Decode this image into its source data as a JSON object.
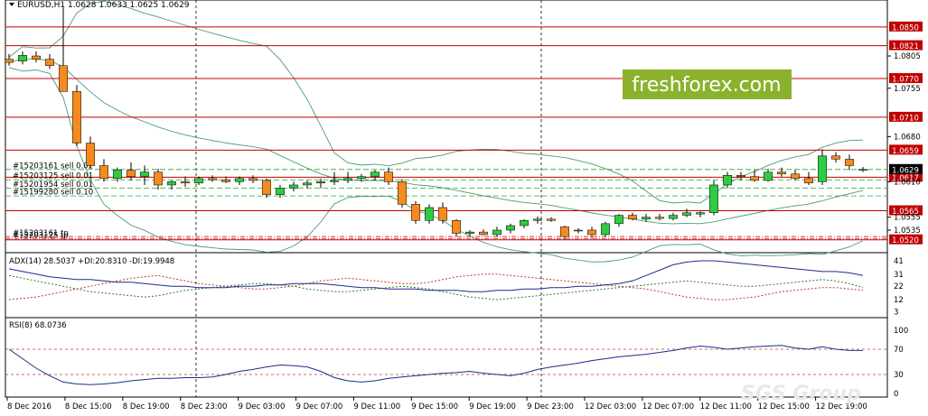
{
  "window": {
    "title": "EURUSD,H1  1.0628 1.0633 1.0625 1.0629",
    "watermark": "freshforex.com",
    "watermark_bottom": "SGS Group"
  },
  "colors": {
    "up_candle": "#2ecc40",
    "down_candle": "#f58a1f",
    "level_line": "#c00000",
    "order_line": "#2ea12e",
    "bollinger": "#4a9a7a",
    "price_badge_red": "#c00000",
    "price_badge_current": "#000000",
    "watermark_bg": "#8bb22d",
    "adx_line": "#1f2a8a",
    "di_plus": "#2e7d32",
    "di_minus": "#c0392b",
    "rsi_line": "#1f2a8a",
    "rsi_level": "#c0392b"
  },
  "price_axis": {
    "ticks": [
      "1.0805",
      "1.0755",
      "1.0680",
      "1.0610",
      "1.0555",
      "1.0535"
    ],
    "ylim": [
      1.05,
      1.0875
    ]
  },
  "levels": [
    {
      "price": 1.085,
      "label": "1.0850"
    },
    {
      "price": 1.0821,
      "label": "1.0821"
    },
    {
      "price": 1.077,
      "label": "1.0770"
    },
    {
      "price": 1.071,
      "label": "1.0710"
    },
    {
      "price": 1.0659,
      "label": "1.0659"
    },
    {
      "price": 1.0617,
      "label": "1.0617"
    },
    {
      "price": 1.0565,
      "label": "1.0565"
    },
    {
      "price": 1.052,
      "label": "1.0520"
    }
  ],
  "current_price": {
    "price": 1.0629,
    "label": "1.0629"
  },
  "orders": [
    {
      "price": 1.0629,
      "label": "#15203161 sell 0.02"
    },
    {
      "price": 1.0613,
      "label": "#15203125 sell 0.01"
    },
    {
      "price": 1.06,
      "label": "#15201954 sell 0.01"
    },
    {
      "price": 1.0588,
      "label": "#15199280 sell 0.10"
    }
  ],
  "tp_lines": [
    {
      "price": 1.0525,
      "label": "#15203161 tp"
    },
    {
      "price": 1.0522,
      "label": "#15203125 tp"
    }
  ],
  "chart_data": {
    "type": "candlestick",
    "symbol": "EURUSD",
    "timeframe": "H1",
    "ohlc_header": [
      1.0628,
      1.0633,
      1.0625,
      1.0629
    ],
    "candles": [
      [
        1.08,
        1.0808,
        1.079,
        1.0795
      ],
      [
        1.0797,
        1.0812,
        1.0792,
        1.0806
      ],
      [
        1.0805,
        1.0812,
        1.0795,
        1.08
      ],
      [
        1.08,
        1.0808,
        1.0785,
        1.079
      ],
      [
        1.079,
        1.088,
        1.0755,
        1.075
      ],
      [
        1.075,
        1.076,
        1.0665,
        1.067
      ],
      [
        1.067,
        1.068,
        1.0632,
        1.0635
      ],
      [
        1.0635,
        1.0645,
        1.061,
        1.0615
      ],
      [
        1.0615,
        1.0632,
        1.061,
        1.0628
      ],
      [
        1.0628,
        1.064,
        1.0612,
        1.0618
      ],
      [
        1.0618,
        1.0635,
        1.0605,
        1.0625
      ],
      [
        1.0625,
        1.063,
        1.0598,
        1.0605
      ],
      [
        1.0605,
        1.0612,
        1.0598,
        1.061
      ],
      [
        1.061,
        1.0618,
        1.0602,
        1.0608
      ],
      [
        1.0608,
        1.0618,
        1.0605,
        1.0615
      ],
      [
        1.0615,
        1.062,
        1.061,
        1.0613
      ],
      [
        1.0613,
        1.0618,
        1.0608,
        1.061
      ],
      [
        1.061,
        1.0618,
        1.0605,
        1.0615
      ],
      [
        1.0615,
        1.062,
        1.0608,
        1.0612
      ],
      [
        1.0612,
        1.0615,
        1.0585,
        1.059
      ],
      [
        1.059,
        1.0605,
        1.0585,
        1.06
      ],
      [
        1.06,
        1.061,
        1.0595,
        1.0605
      ],
      [
        1.0605,
        1.0612,
        1.06,
        1.0608
      ],
      [
        1.0608,
        1.0615,
        1.06,
        1.061
      ],
      [
        1.061,
        1.0625,
        1.0605,
        1.0612
      ],
      [
        1.0612,
        1.0625,
        1.0608,
        1.0615
      ],
      [
        1.0615,
        1.0622,
        1.061,
        1.0618
      ],
      [
        1.0618,
        1.0628,
        1.0612,
        1.0625
      ],
      [
        1.0625,
        1.0632,
        1.0605,
        1.061
      ],
      [
        1.061,
        1.0614,
        1.057,
        1.0575
      ],
      [
        1.0575,
        1.058,
        1.0545,
        1.055
      ],
      [
        1.055,
        1.0575,
        1.0545,
        1.057
      ],
      [
        1.057,
        1.0578,
        1.0545,
        1.055
      ],
      [
        1.055,
        1.0552,
        1.0525,
        1.053
      ],
      [
        1.053,
        1.0535,
        1.0525,
        1.0532
      ],
      [
        1.0532,
        1.0536,
        1.0527,
        1.0528
      ],
      [
        1.0528,
        1.054,
        1.0525,
        1.0535
      ],
      [
        1.0535,
        1.0545,
        1.053,
        1.0542
      ],
      [
        1.0542,
        1.0552,
        1.0538,
        1.055
      ],
      [
        1.055,
        1.0556,
        1.0545,
        1.0552
      ],
      [
        1.0552,
        1.0555,
        1.0548,
        1.055
      ],
      [
        1.054,
        1.0542,
        1.052,
        1.0525
      ],
      [
        1.0535,
        1.0538,
        1.053,
        1.0535
      ],
      [
        1.0535,
        1.054,
        1.0522,
        1.0528
      ],
      [
        1.0528,
        1.0548,
        1.0525,
        1.0545
      ],
      [
        1.0545,
        1.056,
        1.054,
        1.0558
      ],
      [
        1.0558,
        1.0562,
        1.055,
        1.0552
      ],
      [
        1.0552,
        1.056,
        1.0548,
        1.0555
      ],
      [
        1.0555,
        1.056,
        1.055,
        1.0553
      ],
      [
        1.0553,
        1.0562,
        1.055,
        1.0558
      ],
      [
        1.0558,
        1.0568,
        1.0555,
        1.0562
      ],
      [
        1.056,
        1.0564,
        1.0555,
        1.0562
      ],
      [
        1.0562,
        1.0612,
        1.0558,
        1.0605
      ],
      [
        1.0605,
        1.0625,
        1.06,
        1.062
      ],
      [
        1.062,
        1.0625,
        1.0612,
        1.0618
      ],
      [
        1.0618,
        1.0628,
        1.061,
        1.0612
      ],
      [
        1.0612,
        1.063,
        1.061,
        1.0625
      ],
      [
        1.0625,
        1.0632,
        1.0618,
        1.0622
      ],
      [
        1.0622,
        1.0628,
        1.0612,
        1.0615
      ],
      [
        1.0615,
        1.0625,
        1.0605,
        1.0608
      ],
      [
        1.061,
        1.066,
        1.0605,
        1.065
      ],
      [
        1.065,
        1.0656,
        1.064,
        1.0645
      ],
      [
        1.0645,
        1.0652,
        1.0628,
        1.0635
      ],
      [
        1.0628,
        1.0633,
        1.0625,
        1.0629
      ]
    ],
    "xlabels": [
      "8 Dec 2016",
      "8 Dec 15:00",
      "8 Dec 19:00",
      "8 Dec 23:00",
      "9 Dec 03:00",
      "9 Dec 07:00",
      "9 Dec 11:00",
      "9 Dec 15:00",
      "9 Dec 19:00",
      "9 Dec 23:00",
      "12 Dec 03:00",
      "12 Dec 07:00",
      "12 Dec 11:00",
      "12 Dec 15:00",
      "12 Dec 19:00"
    ],
    "adx": {
      "label": "ADX(14) 28.5037 +DI:20.8310 -DI:19.9948",
      "ylim": [
        0,
        45
      ],
      "ticks": [
        "41",
        "31",
        "22",
        "12",
        "3"
      ],
      "adx_values": [
        35,
        33,
        31,
        29,
        28,
        27,
        27,
        26,
        25,
        25,
        24,
        23,
        22,
        22,
        21,
        21,
        21,
        22,
        22,
        23,
        23,
        24,
        24,
        24,
        23,
        22,
        21,
        21,
        20,
        20,
        20,
        19,
        19,
        19,
        18,
        18,
        19,
        19,
        20,
        20,
        21,
        21,
        22,
        22,
        23,
        24,
        26,
        30,
        34,
        38,
        40,
        41,
        41,
        40,
        39,
        38,
        37,
        36,
        35,
        34,
        33,
        33,
        32,
        30
      ],
      "di_plus": [
        30,
        28,
        26,
        24,
        22,
        20,
        18,
        17,
        16,
        15,
        14,
        15,
        17,
        19,
        20,
        21,
        22,
        23,
        24,
        24,
        23,
        22,
        20,
        19,
        18,
        18,
        19,
        20,
        21,
        22,
        21,
        20,
        18,
        16,
        14,
        13,
        12,
        13,
        14,
        15,
        16,
        17,
        18,
        19,
        20,
        21,
        22,
        23,
        24,
        25,
        26,
        25,
        24,
        23,
        22,
        22,
        23,
        24,
        25,
        26,
        27,
        26,
        24,
        21
      ],
      "di_minus": [
        12,
        13,
        14,
        16,
        18,
        20,
        22,
        24,
        26,
        28,
        29,
        30,
        28,
        26,
        24,
        23,
        22,
        21,
        20,
        20,
        21,
        22,
        24,
        26,
        27,
        28,
        27,
        26,
        25,
        24,
        24,
        25,
        27,
        29,
        30,
        31,
        31,
        30,
        29,
        28,
        27,
        26,
        25,
        24,
        23,
        22,
        21,
        20,
        18,
        16,
        14,
        13,
        12,
        12,
        13,
        14,
        16,
        18,
        19,
        20,
        21,
        21,
        20,
        19
      ]
    },
    "rsi": {
      "label": "RSI(8) 68.0736",
      "ylim": [
        0,
        100
      ],
      "levels": [
        70,
        30
      ],
      "ticks": [
        "100",
        "70",
        "30",
        "0"
      ],
      "values": [
        70,
        55,
        40,
        28,
        18,
        15,
        14,
        15,
        17,
        20,
        22,
        24,
        24,
        25,
        25,
        26,
        30,
        35,
        38,
        42,
        45,
        44,
        42,
        35,
        25,
        20,
        18,
        20,
        24,
        26,
        28,
        30,
        32,
        33,
        35,
        32,
        30,
        28,
        32,
        38,
        42,
        45,
        48,
        52,
        55,
        58,
        60,
        62,
        65,
        68,
        72,
        75,
        73,
        70,
        72,
        74,
        75,
        76,
        72,
        70,
        74,
        70,
        68,
        68
      ]
    }
  }
}
